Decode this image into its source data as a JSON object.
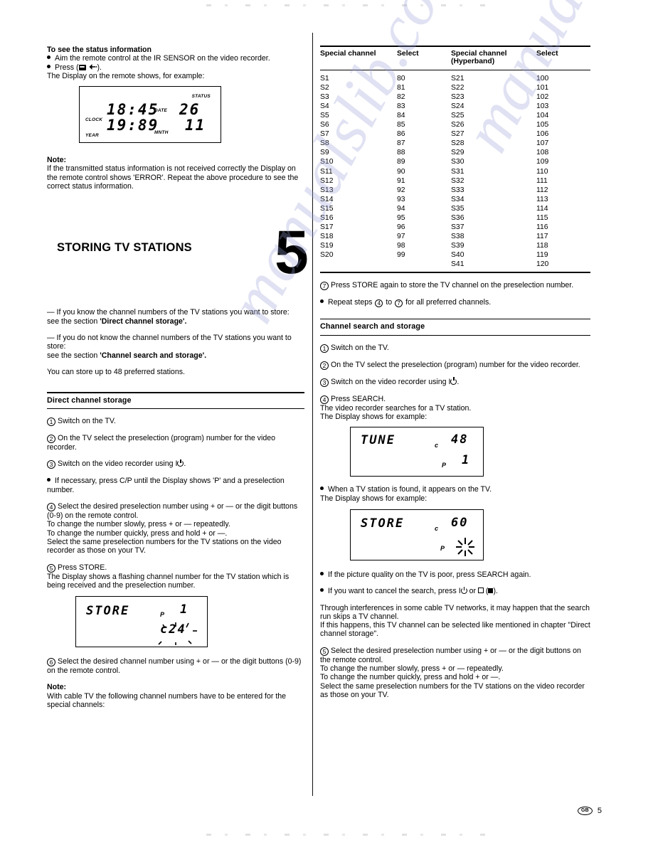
{
  "document": {
    "page_number": "5",
    "region_code": "GB",
    "watermark": "manualslib.com"
  },
  "left_column": {
    "status_section": {
      "heading": "To see the status information",
      "bullet1": "Aim the remote control at the IR SENSOR on the video recorder.",
      "bullet2_prefix": "Press (",
      "bullet2_suffix": ").",
      "lead_in": "The Display on the remote shows, for example:"
    },
    "status_display": {
      "name": "remote-status-lcd",
      "label_status": "STATUS",
      "label_clock": "CLOCK",
      "label_year": "YEAR",
      "label_date": "DATE",
      "label_mnth": "MNTH",
      "time": "18:45",
      "date": "26",
      "year": "19:89",
      "month": "11"
    },
    "note1": {
      "title": "Note:",
      "body": "If the transmitted status information is not received correctly the Display on the remote control shows 'ERROR'. Repeat the above procedure to see the correct status information."
    },
    "chapter": {
      "title": "STORING TV STATIONS",
      "number": "5"
    },
    "intro": {
      "para1_line1": "— If you know the channel numbers of the TV stations you want to store:",
      "para1_line2_prefix": "see the section ",
      "para1_line2_bold": "'Direct channel storage'.",
      "para2_line1": "— If you do not know the channel numbers of the TV stations you want to store:",
      "para2_line2_prefix": "see the section ",
      "para2_line2_bold": "'Channel search and storage'.",
      "para3": "You can store up to 48 preferred stations."
    },
    "direct_storage": {
      "section_title": "Direct channel storage",
      "step1": "Switch on the TV.",
      "step2": "On the TV select the preselection (program) number for the video recorder.",
      "step3_prefix": "Switch on the video recorder using I",
      "step3_suffix": ".",
      "bullet_cp": "If necessary, press C/P until the Display shows 'P' and a preselection number.",
      "step4_line1": "Select the desired preselection number using + or — or the digit buttons (0-9) on the remote control.",
      "step4_line2": "To change the number slowly, press + or — repeatedly.",
      "step4_line3": "To change the number quickly, press and hold + or —.",
      "step4_line4": "Select the same preselection numbers for the TV stations on the video recorder as those on your TV.",
      "step5_line1": "Press STORE.",
      "step5_line2": "The Display shows a flashing channel number for the TV station which is being received and the preselection number.",
      "step6": "Select the desired channel number using + or — or the digit buttons (0-9) on the remote control."
    },
    "store_display": {
      "name": "store-lcd",
      "mode": "STORE",
      "preset_label": "P",
      "preset_value": "1",
      "channel_label": "c",
      "channel_value": "24",
      "channel_flashing": true
    },
    "note2": {
      "title": "Note:",
      "body": "With cable TV the following channel numbers have to be entered for the special channels:"
    }
  },
  "right_column": {
    "table": {
      "headers": [
        "Special channel",
        "Select",
        "Special channel (Hyperband)",
        "Select"
      ],
      "header_left_line1": "Special channel",
      "header_left_line2": "",
      "header_sel_1": "Select",
      "header_right_line1": "Special channel",
      "header_right_line2": "(Hyperband)",
      "header_sel_2": "Select",
      "rows": [
        {
          "ch1": "S1",
          "sel1": "80",
          "ch2": "S21",
          "sel2": "100"
        },
        {
          "ch1": "S2",
          "sel1": "81",
          "ch2": "S22",
          "sel2": "101"
        },
        {
          "ch1": "S3",
          "sel1": "82",
          "ch2": "S23",
          "sel2": "102"
        },
        {
          "ch1": "S4",
          "sel1": "83",
          "ch2": "S24",
          "sel2": "103"
        },
        {
          "ch1": "S5",
          "sel1": "84",
          "ch2": "S25",
          "sel2": "104"
        },
        {
          "ch1": "S6",
          "sel1": "85",
          "ch2": "S26",
          "sel2": "105"
        },
        {
          "ch1": "S7",
          "sel1": "86",
          "ch2": "S27",
          "sel2": "106"
        },
        {
          "ch1": "S8",
          "sel1": "87",
          "ch2": "S28",
          "sel2": "107"
        },
        {
          "ch1": "S9",
          "sel1": "88",
          "ch2": "S29",
          "sel2": "108"
        },
        {
          "ch1": "S10",
          "sel1": "89",
          "ch2": "S30",
          "sel2": "109"
        },
        {
          "ch1": "S11",
          "sel1": "90",
          "ch2": "S31",
          "sel2": "110"
        },
        {
          "ch1": "S12",
          "sel1": "91",
          "ch2": "S32",
          "sel2": "111"
        },
        {
          "ch1": "S13",
          "sel1": "92",
          "ch2": "S33",
          "sel2": "112"
        },
        {
          "ch1": "S14",
          "sel1": "93",
          "ch2": "S34",
          "sel2": "113"
        },
        {
          "ch1": "S15",
          "sel1": "94",
          "ch2": "S35",
          "sel2": "114"
        },
        {
          "ch1": "S16",
          "sel1": "95",
          "ch2": "S36",
          "sel2": "115"
        },
        {
          "ch1": "S17",
          "sel1": "96",
          "ch2": "S37",
          "sel2": "116"
        },
        {
          "ch1": "S18",
          "sel1": "97",
          "ch2": "S38",
          "sel2": "117"
        },
        {
          "ch1": "S19",
          "sel1": "98",
          "ch2": "S39",
          "sel2": "118"
        },
        {
          "ch1": "S20",
          "sel1": "99",
          "ch2": "S40",
          "sel2": "119"
        },
        {
          "ch1": "",
          "sel1": "",
          "ch2": "S41",
          "sel2": "120"
        }
      ]
    },
    "step7_line1": "Press STORE again to store the TV channel on the preselection number.",
    "repeat_bullet_pre": "Repeat steps",
    "repeat_bullet_mid": "to",
    "repeat_bullet_post": "for all preferred channels.",
    "repeat_from": "4",
    "repeat_to": "7",
    "search_storage": {
      "section_title": "Channel search and storage",
      "step1": "Switch on the TV.",
      "step2": "On the TV select the preselection (program) number for the video recorder.",
      "step3_prefix": "Switch on the video recorder using I",
      "step3_suffix": ".",
      "step4_line1": "Press SEARCH.",
      "step4_line2": "The video recorder searches for a TV station.",
      "step4_line3": "The Display shows for example:",
      "found_bullet_line1": "When a TV station is found, it appears on the TV.",
      "found_bullet_line2": "The Display shows for example:",
      "bullet_poor": "If the picture quality on the TV is poor, press SEARCH again.",
      "bullet_cancel_pre": "If you want to cancel the search, press I",
      "bullet_cancel_mid": " or ",
      "bullet_cancel_post": ").",
      "interference_line1": "Through interferences in some cable TV networks, it may happen that the search run skips a TV channel.",
      "interference_line2": "If this happens, this TV channel can be selected like mentioned in chapter \"Direct channel storage\".",
      "step5_line1": "Select the desired preselection number using + or — or the digit buttons on the remote control.",
      "step5_line2": "To change the number slowly, press + or — repeatedly.",
      "step5_line3": "To change the number quickly, press and hold + or —.",
      "step5_line4": "Select the same preselection numbers for the TV stations on the video recorder as those on your TV."
    },
    "tune_display": {
      "name": "tune-lcd",
      "mode": "TUNE",
      "channel_label": "c",
      "channel_value": "48",
      "preset_label": "P",
      "preset_value": "1"
    },
    "store_display": {
      "name": "store-search-lcd",
      "mode": "STORE",
      "channel_label": "c",
      "channel_value": "60",
      "preset_label": "P",
      "preset_value": "",
      "preset_flashing": true
    }
  }
}
